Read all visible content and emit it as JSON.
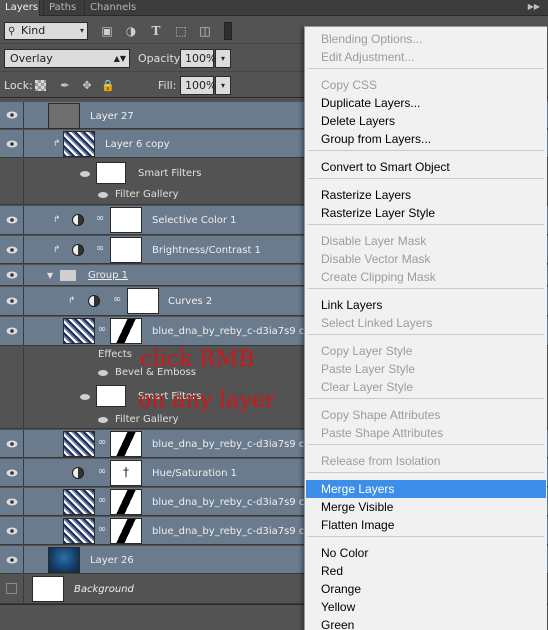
{
  "tabs": [
    "Layers",
    "Paths",
    "Channels"
  ],
  "filter": {
    "kind": "Kind"
  },
  "blend": {
    "mode": "Overlay",
    "opacity_label": "Opacity:",
    "opacity": "100%",
    "fill_label": "Fill:",
    "fill": "100%",
    "lock_label": "Lock:"
  },
  "layers": {
    "l27": "Layer 27",
    "l6copy": "Layer 6 copy",
    "smart_filters_1": "Smart Filters",
    "filter_gallery_1": "Filter Gallery",
    "selective_color": "Selective Color 1",
    "brightness": "Brightness/Contrast 1",
    "group1": "Group 1",
    "curves": "Curves 2",
    "dna1": "blue_dna_by_reby_c-d3ia7s9 copy",
    "effects": "Effects",
    "bevel": "Bevel & Emboss",
    "smart_filters_2": "Smart Filters",
    "filter_gallery_2": "Filter Gallery",
    "dna2": "blue_dna_by_reby_c-d3ia7s9 copy",
    "hue": "Hue/Saturation 1",
    "dna3": "blue_dna_by_reby_c-d3ia7s9 copy",
    "dna4": "blue_dna_by_reby_c-d3ia7s9 copy",
    "l26": "Layer 26",
    "background": "Background"
  },
  "annotation": {
    "line1": "click RMB",
    "line2": "on any layer"
  },
  "menu": {
    "items": [
      {
        "label": "Blending Options...",
        "enabled": false
      },
      {
        "label": "Edit Adjustment...",
        "enabled": false
      },
      {
        "label": "Copy CSS",
        "enabled": false
      },
      {
        "label": "Duplicate Layers...",
        "enabled": true
      },
      {
        "label": "Delete Layers",
        "enabled": true
      },
      {
        "label": "Group from Layers...",
        "enabled": true
      },
      {
        "label": "Convert to Smart Object",
        "enabled": true
      },
      {
        "label": "Rasterize Layers",
        "enabled": true
      },
      {
        "label": "Rasterize Layer Style",
        "enabled": true
      },
      {
        "label": "Disable Layer Mask",
        "enabled": false
      },
      {
        "label": "Disable Vector Mask",
        "enabled": false
      },
      {
        "label": "Create Clipping Mask",
        "enabled": false
      },
      {
        "label": "Link Layers",
        "enabled": true
      },
      {
        "label": "Select Linked Layers",
        "enabled": false
      },
      {
        "label": "Copy Layer Style",
        "enabled": false
      },
      {
        "label": "Paste Layer Style",
        "enabled": false
      },
      {
        "label": "Clear Layer Style",
        "enabled": false
      },
      {
        "label": "Copy Shape Attributes",
        "enabled": false
      },
      {
        "label": "Paste Shape Attributes",
        "enabled": false
      },
      {
        "label": "Release from Isolation",
        "enabled": false
      },
      {
        "label": "Merge Layers",
        "enabled": true,
        "highlighted": true
      },
      {
        "label": "Merge Visible",
        "enabled": true
      },
      {
        "label": "Flatten Image",
        "enabled": true
      },
      {
        "label": "No Color",
        "enabled": true
      },
      {
        "label": "Red",
        "enabled": true
      },
      {
        "label": "Orange",
        "enabled": true
      },
      {
        "label": "Yellow",
        "enabled": true
      },
      {
        "label": "Green",
        "enabled": true
      }
    ]
  },
  "colors": {
    "selection": "#6a7b8e",
    "menu_highlight": "#3d8ee8",
    "annotation": "#d5141a"
  }
}
